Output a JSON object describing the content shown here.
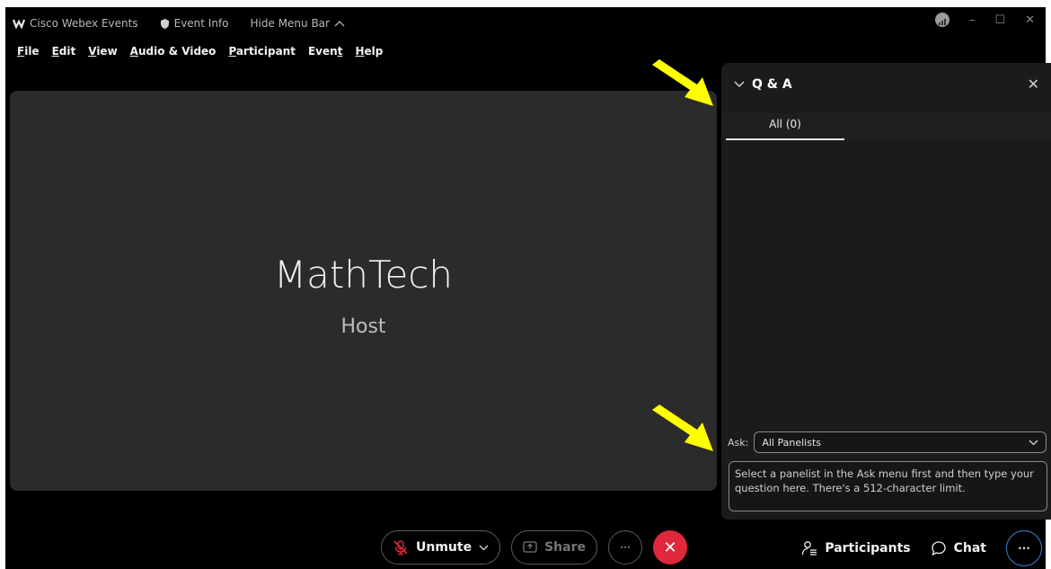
{
  "titlebar": {
    "app_name": "Cisco Webex Events",
    "event_info": "Event Info",
    "hide_menu": "Hide Menu Bar",
    "minimize": "–",
    "maximize": "☐",
    "close": "✕"
  },
  "menu": [
    {
      "pre": "",
      "u": "F",
      "post": "ile"
    },
    {
      "pre": "",
      "u": "E",
      "post": "dit"
    },
    {
      "pre": "",
      "u": "V",
      "post": "iew"
    },
    {
      "pre": "",
      "u": "A",
      "post": "udio & Video"
    },
    {
      "pre": "",
      "u": "P",
      "post": "articipant"
    },
    {
      "pre": "Even",
      "u": "t",
      "post": ""
    },
    {
      "pre": "",
      "u": "H",
      "post": "elp"
    }
  ],
  "stage": {
    "name": "MathTech",
    "role": "Host"
  },
  "qa": {
    "title": "Q & A",
    "close": "✕",
    "tab_all": "All (0)",
    "ask_label": "Ask:",
    "ask_selected": "All Panelists",
    "input_placeholder": "Select a panelist in the Ask menu first and then type your question here. There's a 512-character limit."
  },
  "toolbar": {
    "unmute": "Unmute",
    "share": "Share",
    "more": "···",
    "end": "✕",
    "participants": "Participants",
    "chat": "Chat",
    "overflow": "···"
  },
  "colors": {
    "end_call": "#e0283c",
    "arrow": "#ffff00",
    "panel_bg": "#1b1b1b",
    "stage_bg": "#2b2b2b"
  }
}
